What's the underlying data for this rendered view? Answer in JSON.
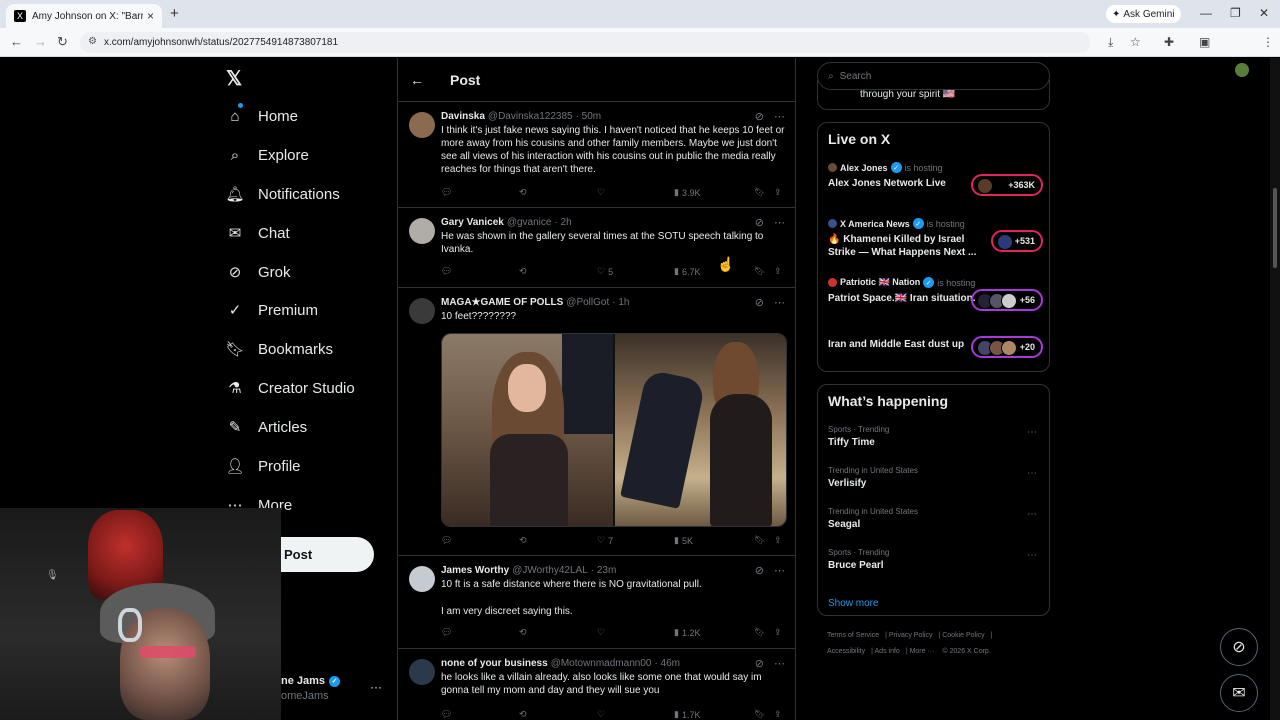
{
  "browser": {
    "tab_title": "Amy Johnson on X: \"Barron's p",
    "tab_close": "×",
    "new_tab": "+",
    "ask_gemini": "Ask Gemini",
    "url": "x.com/amyjohnsonwh/status/2027754914873807181"
  },
  "nav": {
    "logo": "𝕏",
    "items": [
      {
        "label": "Home",
        "icon": "home-icon"
      },
      {
        "label": "Explore",
        "icon": "search-icon"
      },
      {
        "label": "Notifications",
        "icon": "bell-icon"
      },
      {
        "label": "Chat",
        "icon": "mail-icon"
      },
      {
        "label": "Grok",
        "icon": "grok-icon"
      },
      {
        "label": "Premium",
        "icon": "premium-icon"
      },
      {
        "label": "Bookmarks",
        "icon": "bookmark-icon"
      },
      {
        "label": "Creator Studio",
        "icon": "flask-icon"
      },
      {
        "label": "Articles",
        "icon": "article-icon"
      },
      {
        "label": "Profile",
        "icon": "person-icon"
      },
      {
        "label": "More",
        "icon": "more-icon"
      }
    ],
    "post_button": "Post",
    "account_name": "ne Jams",
    "account_handle": "omeJams",
    "account_more": "···"
  },
  "header": {
    "back": "←",
    "title": "Post"
  },
  "tweets": [
    {
      "name": "Davinska",
      "handle": "@Davinska122385",
      "time": "· 50m",
      "text": "I think it's just fake news saying this. I haven't noticed that he keeps 10 feet or more away from his cousins and other family members. Maybe we just don't see all views of his interaction with his cousins out in public the media really reaches for things that aren't there.",
      "replies": "",
      "reposts": "",
      "likes": "",
      "views": "3.9K"
    },
    {
      "name": "Gary Vanicek",
      "handle": "@gvanice",
      "time": "· 2h",
      "text": "He was shown in the gallery several times at the SOTU speech talking to Ivanka.",
      "replies": "",
      "reposts": "",
      "likes": "5",
      "views": "6.7K"
    },
    {
      "name": "MAGA★GAME OF POLLS",
      "handle": "@PollGot",
      "time": "· 1h",
      "text": "10 feet????????",
      "replies": "",
      "reposts": "",
      "likes": "7",
      "views": "5K"
    },
    {
      "name": "James Worthy",
      "handle": "@JWorthy42LAL",
      "time": "· 23m",
      "text": "10 ft is a safe distance where there is NO gravitational pull.",
      "text2": "I am very discreet saying this.",
      "replies": "",
      "reposts": "",
      "likes": "",
      "views": "1.2K"
    },
    {
      "name": "none of your business",
      "handle": "@Motownmadmann00",
      "time": "· 46m",
      "text": "he looks like a villain already. also looks like some one that would say im gonna tell my mom and day and they will sue you",
      "replies": "",
      "reposts": "",
      "likes": "",
      "views": "1.7K"
    }
  ],
  "sidebar": {
    "search_placeholder": "Search",
    "prev_card_text": "through your spirit 🇺🇸",
    "live": {
      "title": "Live on X",
      "items": [
        {
          "host": "Alex Jones",
          "status": "is hosting",
          "title": "Alex Jones Network Live",
          "count": "+363K"
        },
        {
          "host": "X America News",
          "status": "is hosting",
          "title": "🔥 Khamenei Killed by Israel Strike — What Happens Next ...",
          "count": "+531"
        },
        {
          "host": "Patriotic 🇬🇧 Nation",
          "status": "is hosting",
          "title": "Patriot Space.🇬🇧 Iran situation.",
          "count": "+56"
        },
        {
          "host": "",
          "status": "",
          "title": "Iran and Middle East dust up",
          "count": "+20"
        }
      ]
    },
    "happening": {
      "title": "What’s happening",
      "items": [
        {
          "category": "Sports · Trending",
          "topic": "Tiffy Time"
        },
        {
          "category": "Trending in United States",
          "topic": "Verlisify"
        },
        {
          "category": "Trending in United States",
          "topic": "Seagal"
        },
        {
          "category": "Sports · Trending",
          "topic": "Bruce Pearl"
        }
      ],
      "show_more": "Show more"
    },
    "footer": [
      "Terms of Service",
      "Privacy Policy",
      "Cookie Policy",
      "Accessibility",
      "Ads info",
      "More ···",
      "© 2026 X Corp."
    ]
  }
}
